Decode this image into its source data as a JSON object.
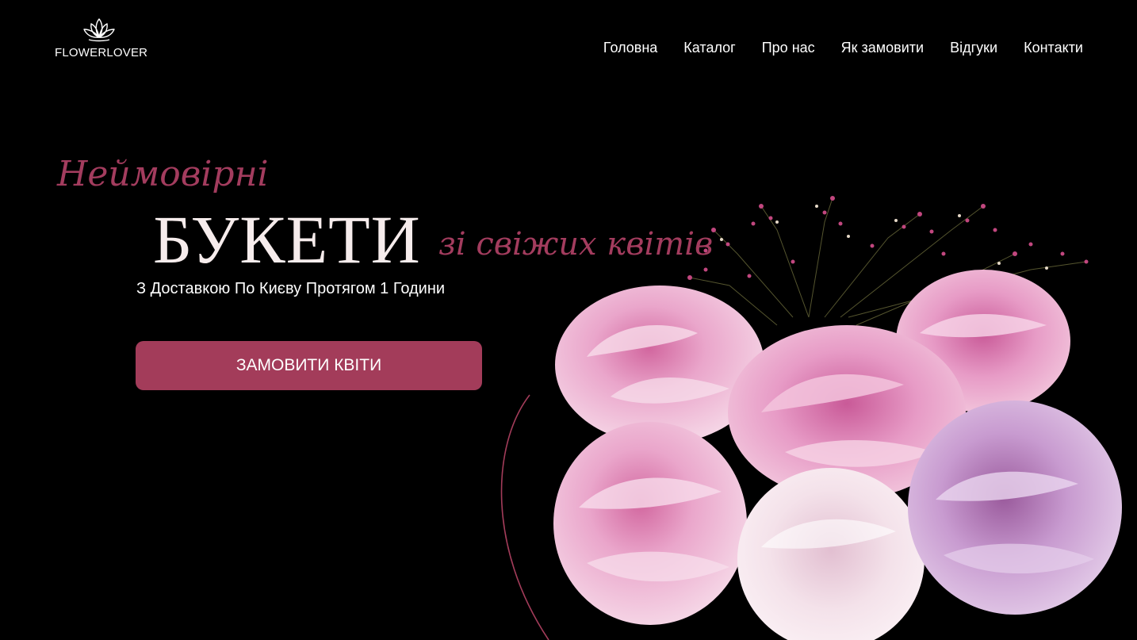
{
  "brand": {
    "name": "FLOWERLOVER",
    "icon": "lotus-icon"
  },
  "nav": {
    "items": [
      {
        "label": "Головна"
      },
      {
        "label": "Каталог"
      },
      {
        "label": "Про нас"
      },
      {
        "label": "Як замовити"
      },
      {
        "label": "Відгуки"
      },
      {
        "label": "Контакти"
      }
    ]
  },
  "hero": {
    "script_line": "Неймовірні",
    "title": "БУКЕТИ",
    "script_tail": "зі свіжих квітів",
    "subtitle": "З Доставкою По Києву Протягом 1 Години",
    "cta_label": "ЗАМОВИТИ КВІТИ",
    "image": "peony-bouquet-photo"
  },
  "colors": {
    "background": "#000000",
    "accent": "#a33c5a",
    "title": "#f6ecec",
    "text": "#ffffff"
  }
}
